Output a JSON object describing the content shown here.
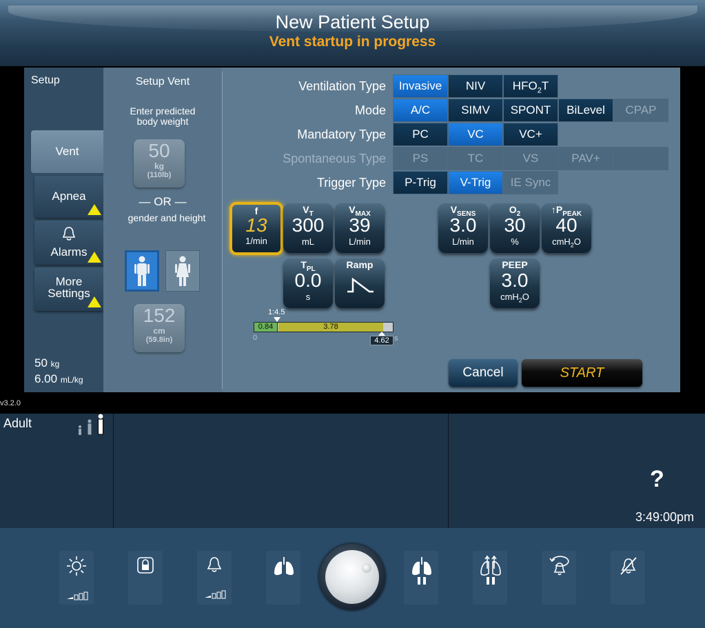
{
  "header": {
    "title": "New Patient Setup",
    "subtitle": "Vent startup in progress"
  },
  "nav": {
    "title": "Setup",
    "tabs": [
      {
        "label": "Vent",
        "active": true,
        "warning": false
      },
      {
        "label": "Apnea",
        "active": false,
        "warning": true
      },
      {
        "label": "Alarms",
        "active": false,
        "warning": true
      },
      {
        "label": "More Settings",
        "active": false,
        "warning": true
      }
    ],
    "weight_value": "50",
    "weight_unit": "kg",
    "ratio_value": "6.00",
    "ratio_unit": "mL/kg"
  },
  "setup_vent": {
    "title": "Setup Vent",
    "instruction": "Enter predicted body weight",
    "weight": {
      "value": "50",
      "unit": "kg",
      "sub": "(110lb)"
    },
    "or_label": "— OR —",
    "gender_label": "gender and height",
    "gender_selected": "male",
    "height": {
      "value": "152",
      "unit": "cm",
      "sub": "(59.8in)"
    }
  },
  "rows": {
    "ventilation_type": {
      "label": "Ventilation Type",
      "options": [
        "Invasive",
        "NIV",
        "HFO2T"
      ],
      "selected": "Invasive"
    },
    "mode": {
      "label": "Mode",
      "options": [
        "A/C",
        "SIMV",
        "SPONT",
        "BiLevel",
        "CPAP"
      ],
      "selected": "A/C",
      "disabled": [
        "CPAP"
      ]
    },
    "mandatory_type": {
      "label": "Mandatory Type",
      "options": [
        "PC",
        "VC",
        "VC+"
      ],
      "selected": "VC"
    },
    "spontaneous_type": {
      "label": "Spontaneous Type",
      "options": [
        "PS",
        "TC",
        "VS",
        "PAV+",
        ""
      ],
      "disabled_all": true
    },
    "trigger_type": {
      "label": "Trigger Type",
      "options": [
        "P-Trig",
        "V-Trig",
        "IE Sync"
      ],
      "selected": "V-Trig",
      "disabled": [
        "IE Sync"
      ]
    }
  },
  "settings": {
    "f": {
      "value": "13",
      "unit": "1/min"
    },
    "vt": {
      "value": "300",
      "unit": "mL"
    },
    "vmax": {
      "value": "39",
      "unit": "L/min"
    },
    "vsens": {
      "value": "3.0",
      "unit": "L/min"
    },
    "o2": {
      "value": "30",
      "unit": "%"
    },
    "tppeak": {
      "value": "40",
      "unit": "cmH2O"
    },
    "tpl": {
      "value": "0.0",
      "unit": "s"
    },
    "ramp": {
      "label": "Ramp"
    },
    "peep": {
      "value": "3.0",
      "unit": "cmH2O"
    }
  },
  "timing_bar": {
    "ratio_label": "1:4.5",
    "ti": "0.84",
    "te": "3.78",
    "total": "4.62",
    "zero": "0",
    "unit": "s"
  },
  "buttons": {
    "cancel": "Cancel",
    "start": "START"
  },
  "status": {
    "version": "v3.2.0",
    "patient_type": "Adult",
    "help": "?",
    "time": "3:49:00pm"
  },
  "hardware_keys": [
    "brightness-key",
    "lock-key",
    "alarm-volume-key",
    "manual-inspiration-key",
    "knob",
    "inspiratory-pause-key",
    "expiratory-pause-key",
    "alarm-reset-key",
    "alarm-silence-key"
  ]
}
